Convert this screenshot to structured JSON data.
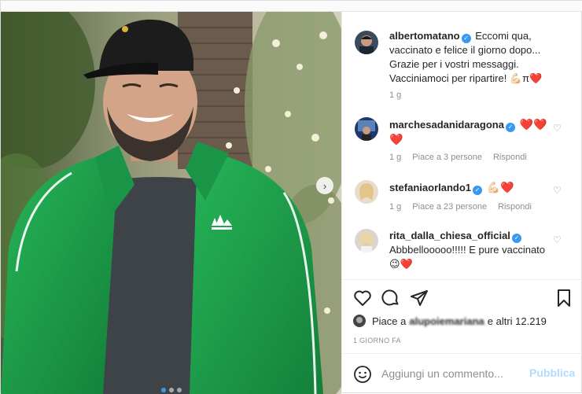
{
  "post": {
    "author": "albertomatano",
    "caption": "Eccomi qua, vaccinato e felice il giorno dopo... Grazie per i vostri messaggi. Vacciniamoci per ripartire! 💪🏻π❤️",
    "caption_age": "1 g"
  },
  "comments": [
    {
      "user": "marchesadanidaragona",
      "text": "❤️❤️❤️",
      "age": "1 g",
      "likes": "Piace a 3 persone",
      "reply": "Rispondi"
    },
    {
      "user": "stefaniaorlando1",
      "text": "💪🏻❤️",
      "age": "1 g",
      "likes": "Piace a 23 persone",
      "reply": "Rispondi"
    },
    {
      "user": "rita_dalla_chiesa_official",
      "text": "Abbbellooooo!!!!! E pure vaccinato😉❤️"
    }
  ],
  "likes_summary": {
    "prefix": "Piace a",
    "hidden_user": "alupoiemariana",
    "suffix": "e altri 12.219"
  },
  "date_label": "1 GIORNO FA",
  "comment_box": {
    "placeholder": "Aggiungi un commento...",
    "publish_label": "Pubblica"
  },
  "carousel": {
    "current": 1,
    "total": 3
  },
  "icons": {
    "like": "heart-icon",
    "comment": "speech-bubble-icon",
    "share": "paper-plane-icon",
    "save": "bookmark-icon",
    "emoji": "smiley-icon",
    "next": "chevron-right-icon",
    "verified": "verified-badge-icon"
  },
  "colors": {
    "verified": "#3897f0",
    "link_disabled": "#b3dbff",
    "jacket": "#1fa24a",
    "muted_text": "#8e8e8e"
  }
}
